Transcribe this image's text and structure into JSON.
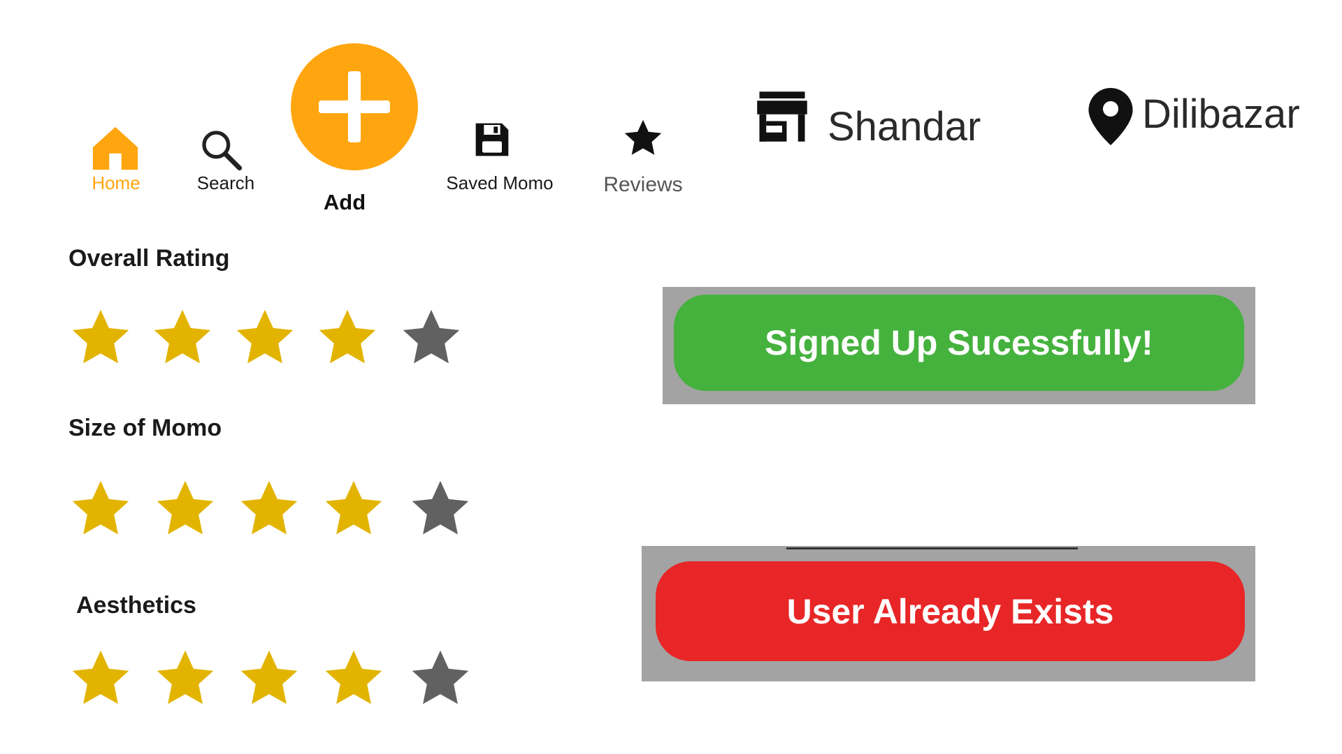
{
  "nav": {
    "items": [
      {
        "label": "Home",
        "icon": "home-icon",
        "active": true
      },
      {
        "label": "Search",
        "icon": "search-icon"
      },
      {
        "label": "Add",
        "icon": "plus-icon"
      },
      {
        "label": "Saved Momo",
        "icon": "floppy-disk-icon"
      },
      {
        "label": "Reviews",
        "icon": "star-icon"
      }
    ]
  },
  "place": {
    "name": "Shandar",
    "location": "Dilibazar"
  },
  "ratings": [
    {
      "title": "Overall Rating",
      "value": 4,
      "max": 5
    },
    {
      "title": "Size of Momo",
      "value": 4,
      "max": 5
    },
    {
      "title": "Aesthetics",
      "value": 4,
      "max": 5
    }
  ],
  "toasts": {
    "success": "Signed Up Sucessfully!",
    "error": "User Already Exists"
  },
  "colors": {
    "accent": "#FFA50F",
    "star_filled": "#E2B400",
    "star_empty": "#616161",
    "success": "#45B23E",
    "error": "#E82627",
    "toast_backdrop": "#A3A3A3"
  }
}
